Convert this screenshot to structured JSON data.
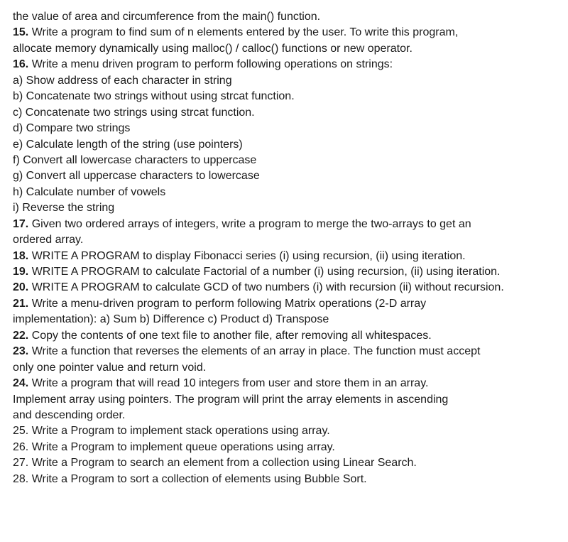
{
  "document": {
    "lines": [
      {
        "num": "",
        "text": "the value of area and circumference from the main() function."
      },
      {
        "num": "15.",
        "text": " Write a program to find sum of n elements entered by the user. To write this program,"
      },
      {
        "num": "",
        "text": "allocate memory dynamically using malloc() / calloc() functions or new operator."
      },
      {
        "num": "16.",
        "text": " Write a menu driven program to perform following operations on strings:"
      },
      {
        "num": "",
        "text": "a) Show address of each character in string"
      },
      {
        "num": "",
        "text": "b) Concatenate two strings without using strcat function."
      },
      {
        "num": "",
        "text": "c) Concatenate two strings using strcat function."
      },
      {
        "num": "",
        "text": "d) Compare two strings"
      },
      {
        "num": "",
        "text": "e) Calculate length of the string (use pointers)"
      },
      {
        "num": "",
        "text": "f) Convert all lowercase characters to uppercase"
      },
      {
        "num": "",
        "text": "g) Convert all uppercase characters to lowercase"
      },
      {
        "num": "",
        "text": "h) Calculate number of vowels"
      },
      {
        "num": "",
        "text": "i) Reverse the string"
      },
      {
        "num": "17.",
        "text": " Given two ordered arrays of integers, write a program to merge the two-arrays to get an"
      },
      {
        "num": "",
        "text": "ordered array."
      },
      {
        "num": "18.",
        "text": " WRITE A PROGRAM to display Fibonacci series (i) using recursion, (ii) using iteration."
      },
      {
        "num": "19.",
        "text": " WRITE A PROGRAM to calculate Factorial of a number (i) using recursion, (ii) using iteration."
      },
      {
        "num": "20.",
        "text": " WRITE A PROGRAM to calculate GCD of two numbers (i) with recursion (ii) without recursion."
      },
      {
        "num": "21.",
        "text": " Write a menu-driven program to perform following Matrix operations (2-D array"
      },
      {
        "num": "",
        "text": "implementation): a) Sum b) Difference c) Product d) Transpose"
      },
      {
        "num": "22.",
        "text": " Copy the contents of one text file to another file, after removing all whitespaces."
      },
      {
        "num": "23.",
        "text": " Write a function that reverses the elements of an array in place. The function must accept"
      },
      {
        "num": "",
        "text": "only one pointer value and return void."
      },
      {
        "num": "24.",
        "text": " Write a program that will read 10 integers from user and store them in an array."
      },
      {
        "num": "",
        "text": "Implement array using pointers. The program will print the array elements in ascending"
      },
      {
        "num": "",
        "text": "and descending order."
      },
      {
        "num": "",
        "text": "25. Write a Program to implement stack operations using array."
      },
      {
        "num": "",
        "text": "26. Write a Program to implement queue operations using array."
      },
      {
        "num": "",
        "text": "27. Write a Program to search an element from a collection using Linear Search."
      },
      {
        "num": "",
        "text": "28. Write a Program to sort a collection of elements using Bubble Sort."
      }
    ]
  }
}
